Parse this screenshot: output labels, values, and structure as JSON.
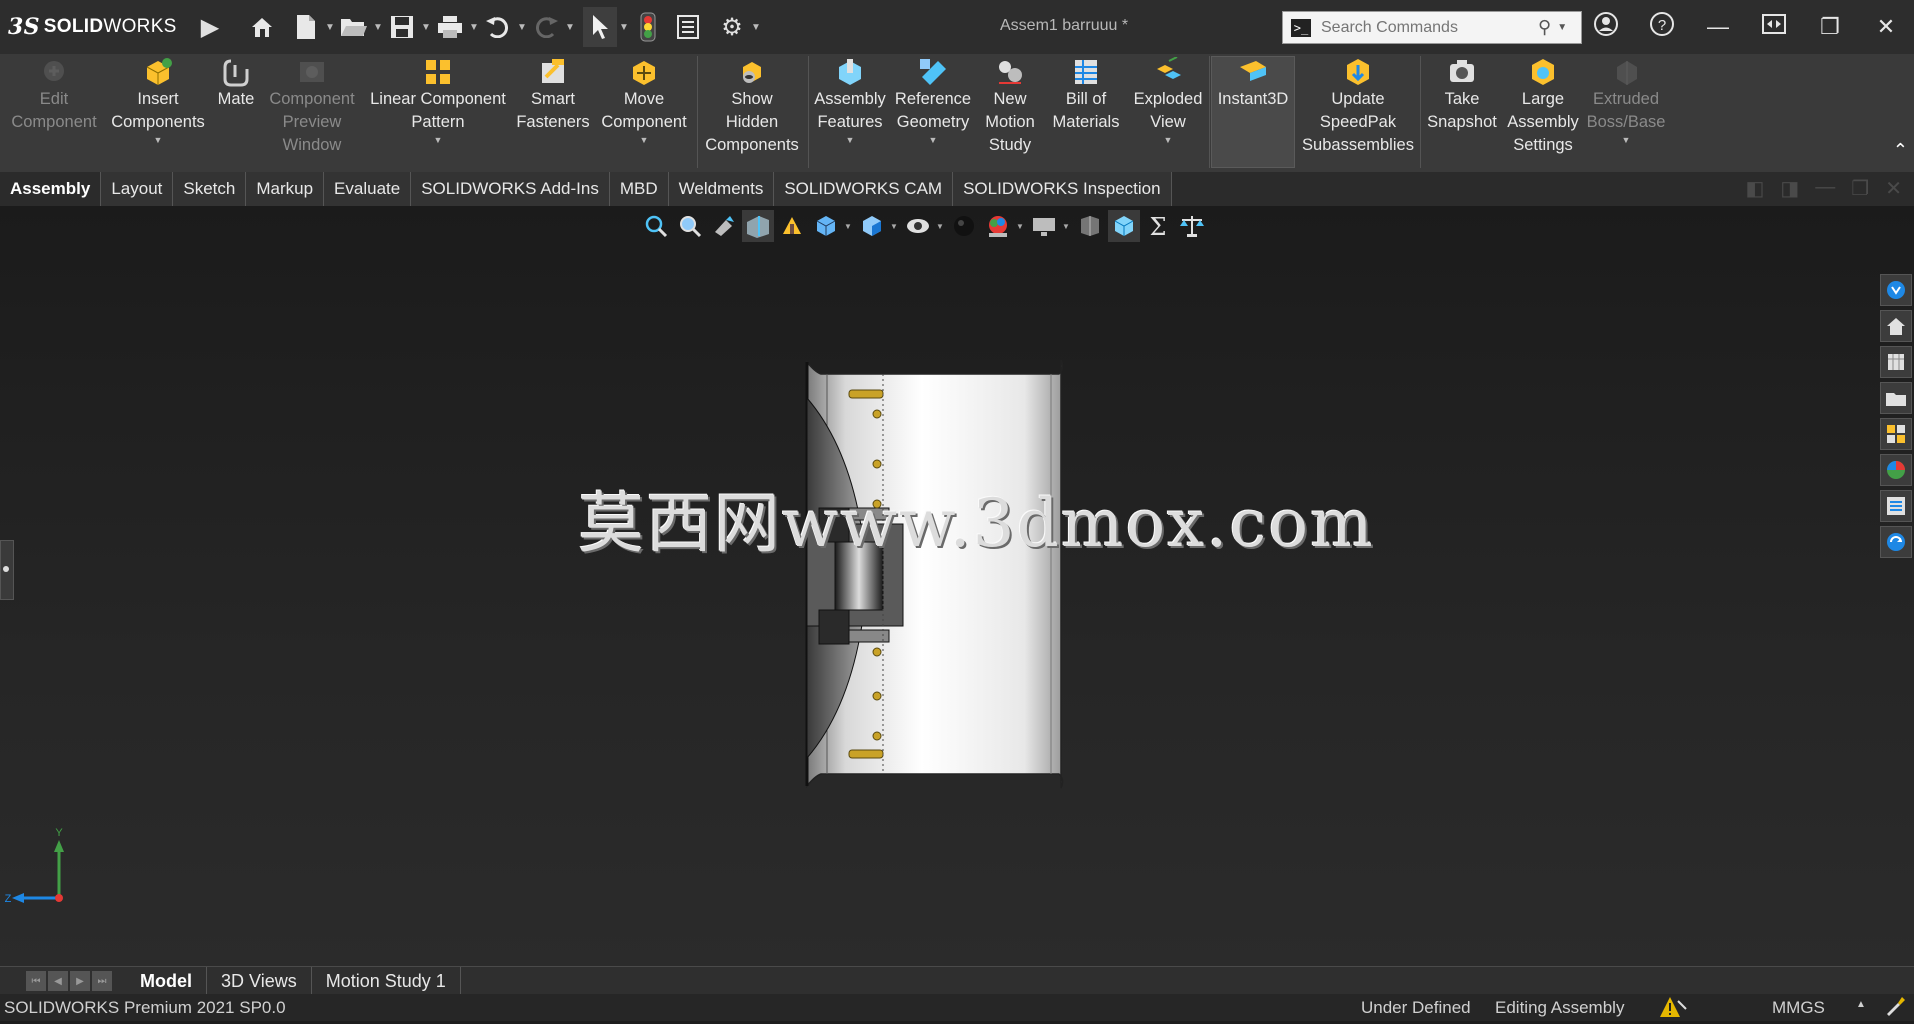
{
  "app": {
    "logo": {
      "ds": "3S",
      "bold": "SOLID",
      "thin": "WORKS"
    },
    "document_title": "Assem1 barruuu *",
    "search": {
      "placeholder": "Search Commands"
    }
  },
  "quick_access": {
    "icons": [
      "play-icon",
      "home-icon",
      "new-document-icon",
      "open-icon",
      "save-icon",
      "print-icon",
      "undo-icon",
      "redo-icon",
      "select-icon",
      "rebuild-icon",
      "file-properties-icon",
      "options-icon"
    ]
  },
  "window_controls": [
    "user-icon",
    "help-icon",
    "minimize-icon",
    "restore-icon",
    "maximize-icon",
    "close-icon"
  ],
  "ribbon": {
    "buttons": [
      {
        "id": "edit-component",
        "lines": [
          "Edit",
          "Component"
        ],
        "disabled": true,
        "caret": false
      },
      {
        "id": "insert-components",
        "lines": [
          "Insert",
          "Components"
        ],
        "disabled": false,
        "caret": true
      },
      {
        "id": "mate",
        "lines": [
          "Mate"
        ],
        "disabled": false,
        "caret": false
      },
      {
        "id": "component-preview-window",
        "lines": [
          "Component",
          "Preview",
          "Window"
        ],
        "disabled": true,
        "caret": false
      },
      {
        "id": "linear-component-pattern",
        "lines": [
          "Linear Component",
          "Pattern"
        ],
        "disabled": false,
        "caret": true
      },
      {
        "id": "smart-fasteners",
        "lines": [
          "Smart",
          "Fasteners"
        ],
        "disabled": false,
        "caret": false
      },
      {
        "id": "move-component",
        "lines": [
          "Move",
          "Component"
        ],
        "disabled": false,
        "caret": true
      },
      {
        "id": "show-hidden-components",
        "lines": [
          "Show",
          "Hidden",
          "Components"
        ],
        "disabled": false,
        "caret": false
      },
      {
        "id": "assembly-features",
        "lines": [
          "Assembly",
          "Features"
        ],
        "disabled": false,
        "caret": true
      },
      {
        "id": "reference-geometry",
        "lines": [
          "Reference",
          "Geometry"
        ],
        "disabled": false,
        "caret": true
      },
      {
        "id": "new-motion-study",
        "lines": [
          "New",
          "Motion",
          "Study"
        ],
        "disabled": false,
        "caret": false
      },
      {
        "id": "bill-of-materials",
        "lines": [
          "Bill of",
          "Materials"
        ],
        "disabled": false,
        "caret": false
      },
      {
        "id": "exploded-view",
        "lines": [
          "Exploded",
          "View"
        ],
        "disabled": false,
        "caret": true
      },
      {
        "id": "instant3d",
        "lines": [
          "Instant3D"
        ],
        "disabled": false,
        "caret": false
      },
      {
        "id": "update-speedpak",
        "lines": [
          "Update",
          "SpeedPak",
          "Subassemblies"
        ],
        "disabled": false,
        "caret": false
      },
      {
        "id": "take-snapshot",
        "lines": [
          "Take",
          "Snapshot"
        ],
        "disabled": false,
        "caret": false
      },
      {
        "id": "large-assembly-settings",
        "lines": [
          "Large",
          "Assembly",
          "Settings"
        ],
        "disabled": false,
        "caret": false
      },
      {
        "id": "extruded-boss-base",
        "lines": [
          "Extruded",
          "Boss/Base"
        ],
        "disabled": true,
        "caret": true
      }
    ]
  },
  "command_tabs": [
    "Assembly",
    "Layout",
    "Sketch",
    "Markup",
    "Evaluate",
    "SOLIDWORKS Add-Ins",
    "MBD",
    "Weldments",
    "SOLIDWORKS CAM",
    "SOLIDWORKS Inspection"
  ],
  "active_command_tab": "Assembly",
  "heads_up_toolbar": [
    "zoom-to-fit-icon",
    "zoom-to-area-icon",
    "previous-view-icon",
    "section-view-icon",
    "dynamic-annotation-icon",
    "view-orientation-icon",
    "display-style-icon",
    "hide-show-icon",
    "edit-appearance-icon",
    "apply-scene-icon",
    "view-settings-icon",
    "render-tools-icon",
    "toolbox-icon",
    "sigma-icon",
    "balance-icon"
  ],
  "task_pane": [
    "solidworks-resources-icon",
    "design-library-icon",
    "file-explorer-icon",
    "view-palette-icon",
    "appearances-icon",
    "custom-properties-icon",
    "3dexperience-icon"
  ],
  "viewport": {
    "watermark": "莫西网www.3dmox.com",
    "triad": {
      "y": "Y",
      "z": "Z"
    }
  },
  "bottom_tabs": [
    "Model",
    "3D Views",
    "Motion Study 1"
  ],
  "active_bottom_tab": "Model",
  "status": {
    "product": "SOLIDWORKS Premium 2021 SP0.0",
    "definition": "Under Defined",
    "mode": "Editing Assembly",
    "units": "MMGS"
  },
  "colors": {
    "ribbon_bg": "#3a3a3a",
    "title_bg": "#2d2d2d",
    "viewport_top": "#1b1b1b",
    "accent_yellow": "#e5b700"
  }
}
